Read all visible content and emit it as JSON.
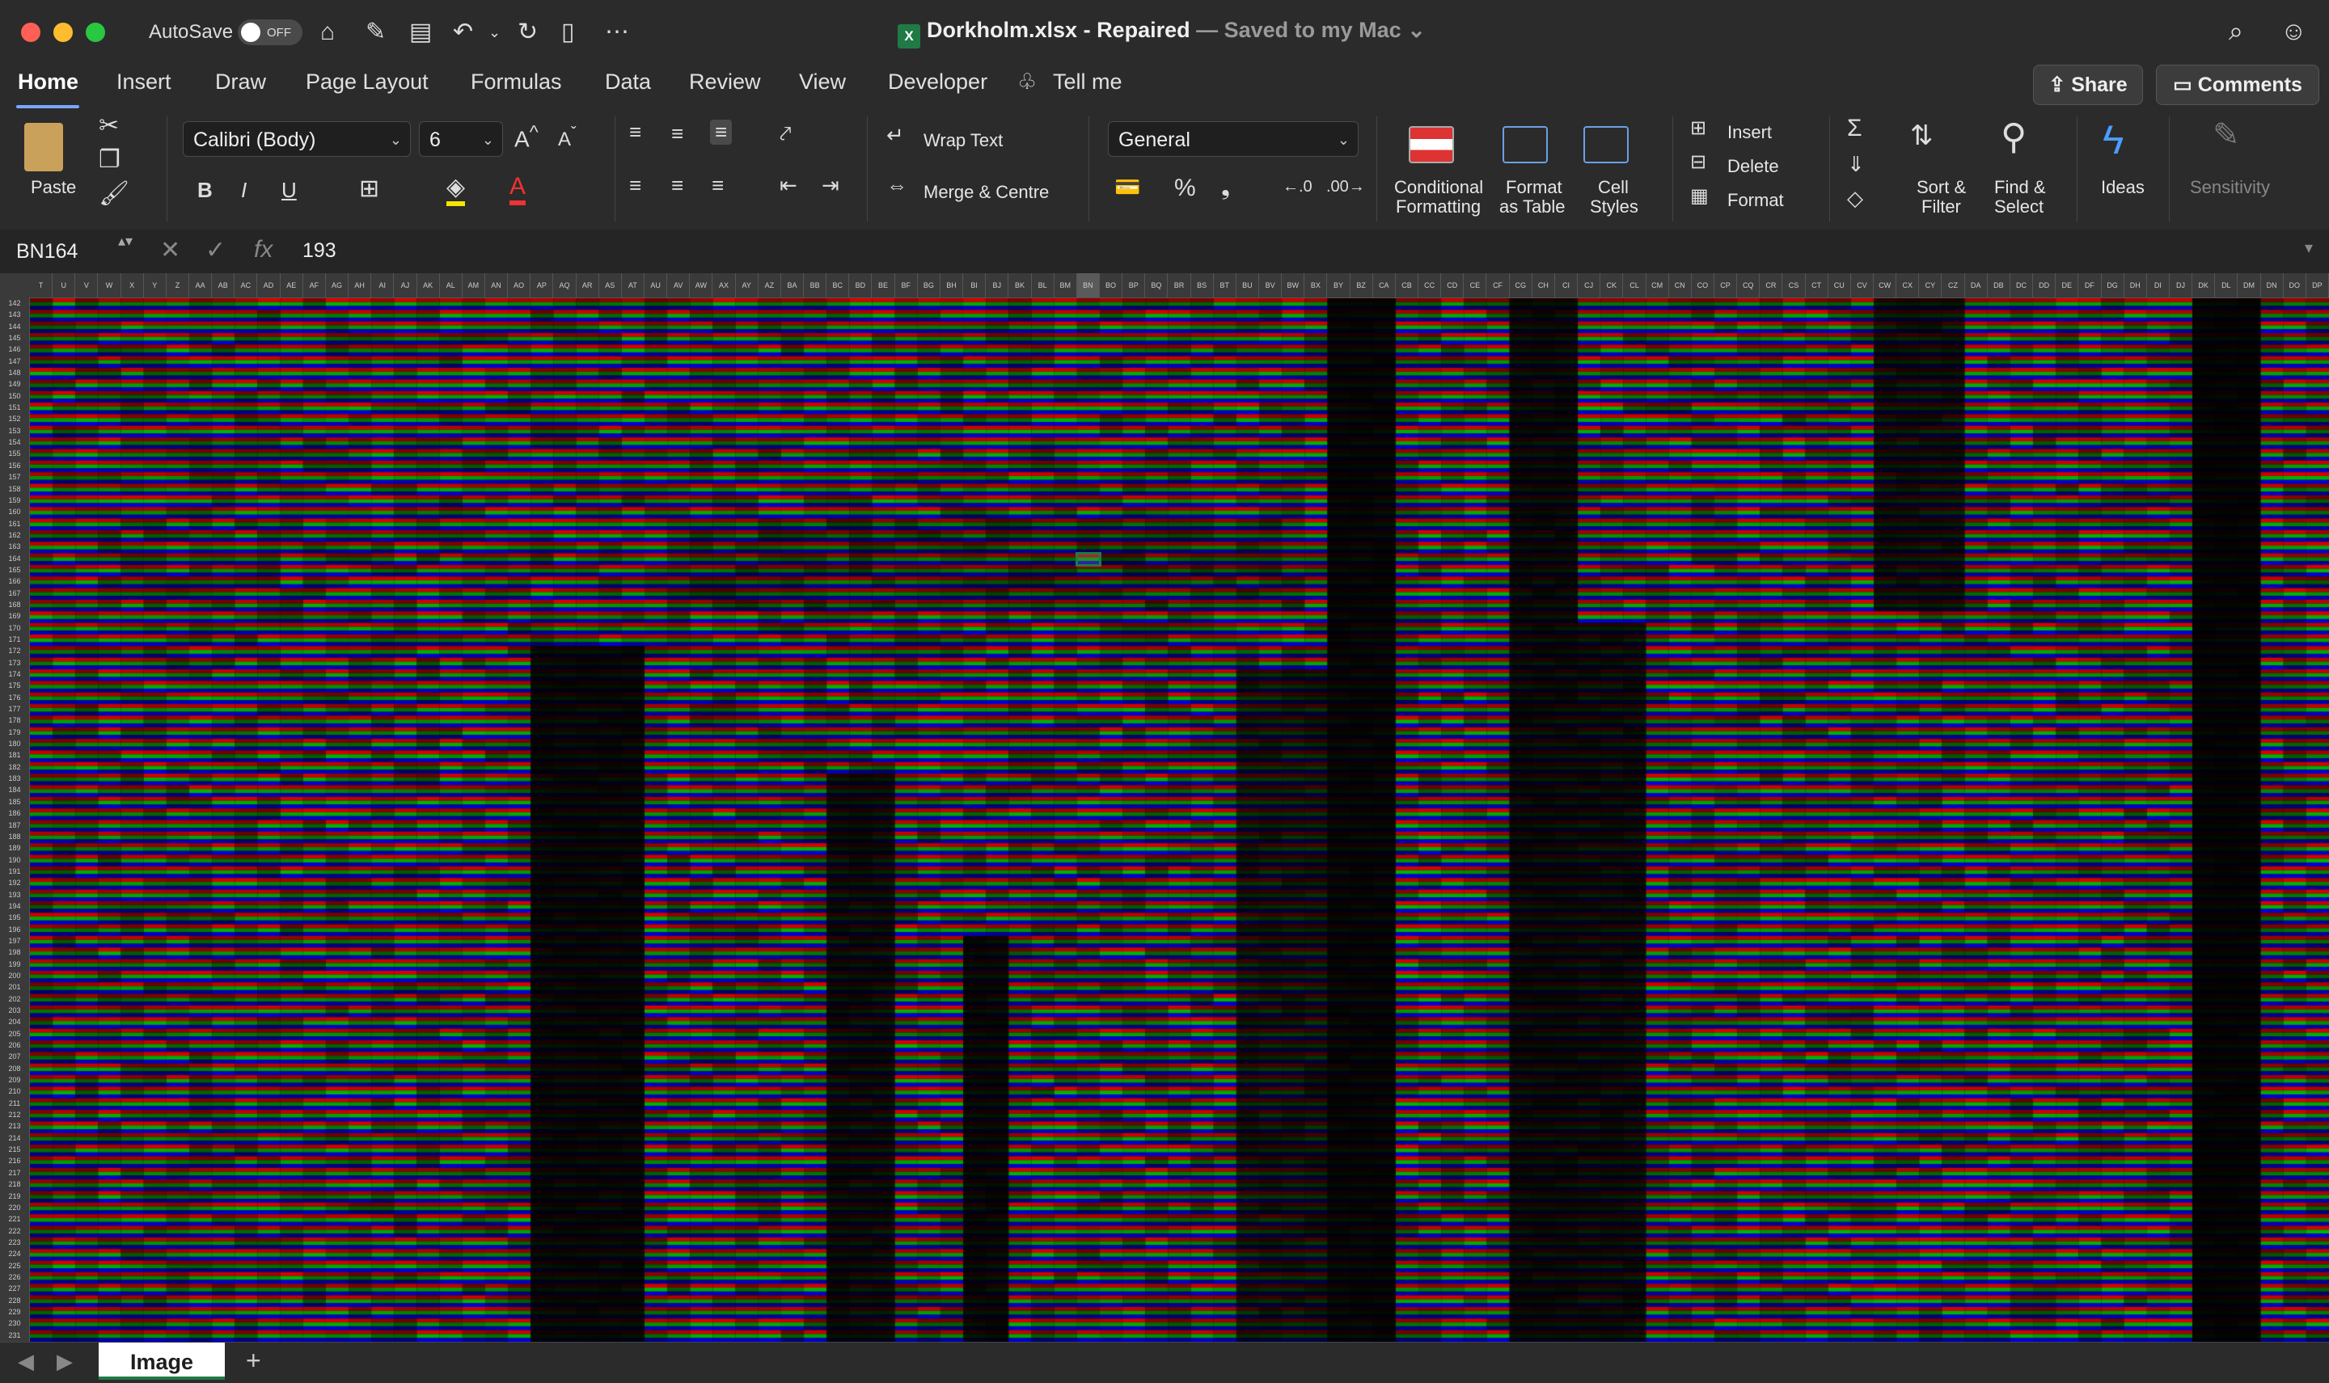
{
  "window": {
    "autosave_label": "AutoSave",
    "autosave_state": "OFF",
    "file_name": "Dorkholm.xlsx",
    "status_sep": " - ",
    "status": "Repaired",
    "save_status": " — Saved to my Mac"
  },
  "tabs": [
    "Home",
    "Insert",
    "Draw",
    "Page Layout",
    "Formulas",
    "Data",
    "Review",
    "View",
    "Developer",
    "Tell me"
  ],
  "share_label": "Share",
  "comments_label": "Comments",
  "ribbon": {
    "paste": "Paste",
    "font_name": "Calibri (Body)",
    "font_size": "6",
    "wrap_text": "Wrap Text",
    "merge_centre": "Merge & Centre",
    "number_format": "General",
    "cond_format_1": "Conditional",
    "cond_format_2": "Formatting",
    "format_table_1": "Format",
    "format_table_2": "as Table",
    "cell_styles_1": "Cell",
    "cell_styles_2": "Styles",
    "insert": "Insert",
    "delete": "Delete",
    "format": "Format",
    "sort_1": "Sort &",
    "sort_2": "Filter",
    "find_1": "Find &",
    "find_2": "Select",
    "ideas": "Ideas",
    "sensitivity": "Sensitivity",
    "bold": "B",
    "italic": "I",
    "underline": "U",
    "percent": "%"
  },
  "formula_bar": {
    "cell_ref": "BN164",
    "fx": "fx",
    "value": "193"
  },
  "columns": [
    "T",
    "U",
    "V",
    "W",
    "X",
    "Y",
    "Z",
    "AA",
    "AB",
    "AC",
    "AD",
    "AE",
    "AF",
    "AG",
    "AH",
    "AI",
    "AJ",
    "AK",
    "AL",
    "AM",
    "AN",
    "AO",
    "AP",
    "AQ",
    "AR",
    "AS",
    "AT",
    "AU",
    "AV",
    "AW",
    "AX",
    "AY",
    "AZ",
    "BA",
    "BB",
    "BC",
    "BD",
    "BE",
    "BF",
    "BG",
    "BH",
    "BI",
    "BJ",
    "BK",
    "BL",
    "BM",
    "BN",
    "BO",
    "BP",
    "BQ",
    "BR",
    "BS",
    "BT",
    "BU",
    "BV",
    "BW",
    "BX",
    "BY",
    "BZ",
    "CA",
    "CB",
    "CC",
    "CD",
    "CE",
    "CF",
    "CG",
    "CH",
    "CI",
    "CJ",
    "CK",
    "CL",
    "CM",
    "CN",
    "CO",
    "CP",
    "CQ",
    "CR",
    "CS",
    "CT",
    "CU",
    "CV",
    "CW",
    "CX",
    "CY",
    "CZ",
    "DA",
    "DB",
    "DC",
    "DD",
    "DE",
    "DF",
    "DG",
    "DH",
    "DI",
    "DJ",
    "DK",
    "DL",
    "DM",
    "DN",
    "DO",
    "DP"
  ],
  "row_start": 142,
  "row_end": 231,
  "selected_column": "BN",
  "selected_row": 164,
  "sheet_tab": "Image",
  "add_sheet": "+"
}
